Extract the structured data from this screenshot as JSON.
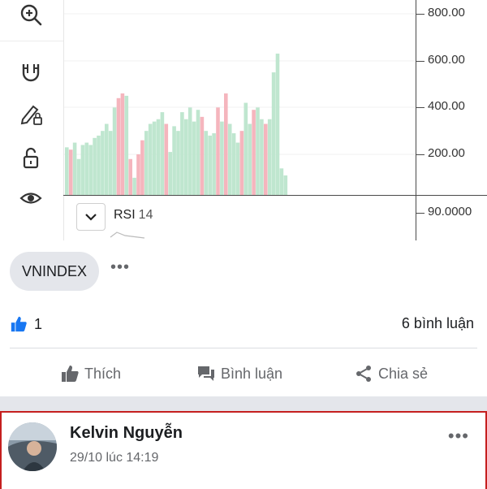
{
  "chart": {
    "price_labels": [
      "800.00",
      "600.00",
      "400.00",
      "200.00"
    ],
    "rsi_value_label": "90.0000",
    "indicator": {
      "name": "RSI",
      "period": "14"
    },
    "colors": {
      "up": "#bfe6cf",
      "down": "#f5b5bd",
      "grid": "#f0f0f0"
    }
  },
  "chart_data": {
    "type": "bar",
    "title": "",
    "ylabel": "",
    "ylim": [
      0,
      900
    ],
    "yticks": [
      200,
      400,
      600,
      800
    ],
    "series": [
      {
        "values": [
          230,
          220,
          250,
          180,
          240,
          250,
          240,
          270,
          280,
          300,
          330,
          300,
          400,
          440,
          460,
          450,
          180,
          100,
          200,
          260,
          300,
          330,
          340,
          350,
          380,
          330,
          210,
          320,
          300,
          380,
          350,
          400,
          340,
          390,
          360,
          300,
          280,
          290,
          400,
          340,
          460,
          330,
          290,
          250,
          300,
          420,
          330,
          390,
          400,
          350,
          330,
          350,
          550,
          630,
          140,
          110
        ],
        "colors": [
          "g",
          "r",
          "g",
          "g",
          "g",
          "g",
          "g",
          "g",
          "g",
          "g",
          "g",
          "g",
          "g",
          "r",
          "r",
          "g",
          "r",
          "g",
          "r",
          "r",
          "g",
          "g",
          "g",
          "g",
          "g",
          "r",
          "g",
          "g",
          "g",
          "g",
          "g",
          "g",
          "g",
          "g",
          "r",
          "g",
          "g",
          "g",
          "r",
          "g",
          "r",
          "g",
          "g",
          "g",
          "r",
          "g",
          "g",
          "r",
          "g",
          "g",
          "r",
          "g",
          "g",
          "g",
          "g",
          "g"
        ]
      }
    ]
  },
  "tag": {
    "label": "VNINDEX",
    "more": "•••"
  },
  "stats": {
    "likes": "1",
    "comments": "6 bình luận"
  },
  "actions": {
    "like": "Thích",
    "comment": "Bình luận",
    "share": "Chia sẻ"
  },
  "comment": {
    "author": "Kelvin Nguyễn",
    "timestamp": "29/10 lúc 14:19",
    "more": "•••"
  }
}
